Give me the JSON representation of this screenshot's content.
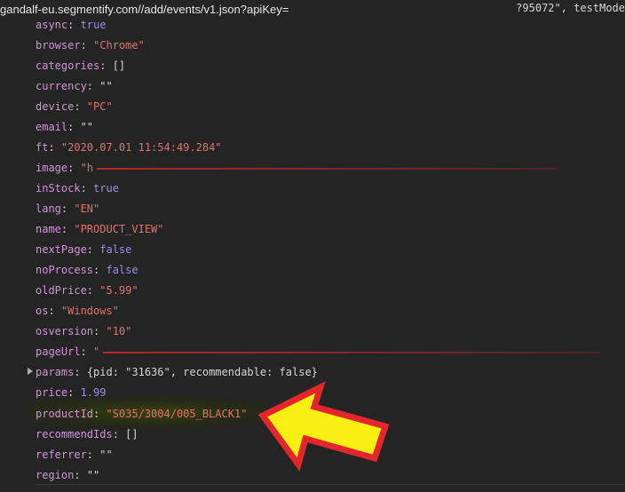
{
  "header": {
    "url": "gandalf-eu.segmentify.com//add/events/v1.json?apiKey=",
    "url_tail": "?95072\", testMode"
  },
  "properties": [
    {
      "key": "async",
      "value": "true",
      "type": "kw"
    },
    {
      "key": "browser",
      "value": "\"Chrome\"",
      "type": "str"
    },
    {
      "key": "categories",
      "value": "[]",
      "type": "plain"
    },
    {
      "key": "currency",
      "value": "\"\"",
      "type": "plain"
    },
    {
      "key": "device",
      "value": "\"PC\"",
      "type": "str"
    },
    {
      "key": "email",
      "value": "\"\"",
      "type": "plain"
    },
    {
      "key": "ft",
      "value": "\"2020.07.01 11:54:49.284\"",
      "type": "str"
    },
    {
      "key": "image",
      "value": "\"h",
      "type": "str",
      "redacted": true
    },
    {
      "key": "inStock",
      "value": "true",
      "type": "kw"
    },
    {
      "key": "lang",
      "value": "\"EN\"",
      "type": "str"
    },
    {
      "key": "name",
      "value": "\"PRODUCT_VIEW\"",
      "type": "str"
    },
    {
      "key": "nextPage",
      "value": "false",
      "type": "kw"
    },
    {
      "key": "noProcess",
      "value": "false",
      "type": "kw"
    },
    {
      "key": "oldPrice",
      "value": "\"5.99\"",
      "type": "str"
    },
    {
      "key": "os",
      "value": "\"Windows\"",
      "type": "str"
    },
    {
      "key": "osversion",
      "value": "\"10\"",
      "type": "str"
    },
    {
      "key": "pageUrl",
      "value": "\"",
      "type": "str",
      "redacted": true
    },
    {
      "key": "params",
      "value": "{pid: \"31636\", recommendable: false}",
      "type": "plain",
      "expandable": true
    },
    {
      "key": "price",
      "value": "1.99",
      "type": "num"
    },
    {
      "key": "productId",
      "value": "\"S035/3004/005_BLACK1\"",
      "type": "str",
      "highlighted": true
    },
    {
      "key": "recommendIds",
      "value": "[]",
      "type": "plain"
    },
    {
      "key": "referrer",
      "value": "\"\"",
      "type": "plain"
    },
    {
      "key": "region",
      "value": "\"\"",
      "type": "plain"
    }
  ],
  "annotation": {
    "arrow_fill": "#f7ee12",
    "arrow_stroke": "#e3262b",
    "target": "productId"
  }
}
